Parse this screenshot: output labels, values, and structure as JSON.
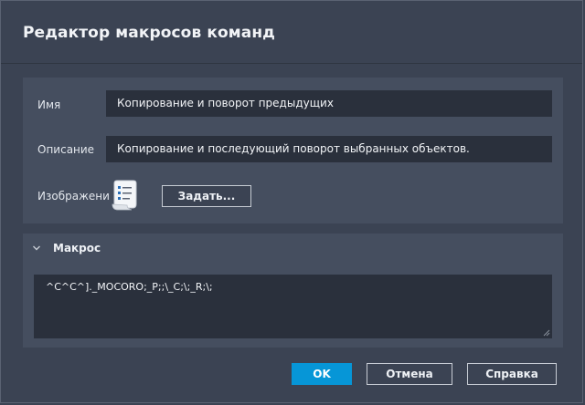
{
  "dialog": {
    "title": "Редактор макросов команд"
  },
  "fields": {
    "name_label": "Имя",
    "name_value": "Копирование и поворот предыдущих",
    "description_label": "Описание",
    "description_value": "Копирование и последующий поворот выбранных объектов.",
    "image_label": "Изображени",
    "image_icon": "script-document-icon",
    "set_button": "Задать..."
  },
  "macro_section": {
    "title": "Макрос",
    "expanded": true,
    "value": "^C^C^]._MOCORO;_P;;\\_C;\\;_R;\\;"
  },
  "buttons": {
    "ok": "OK",
    "cancel": "Отмена",
    "help": "Справка"
  },
  "colors": {
    "accent": "#0696d7",
    "background": "#3b4353",
    "panel": "#454e5f",
    "field": "#2a303c"
  }
}
